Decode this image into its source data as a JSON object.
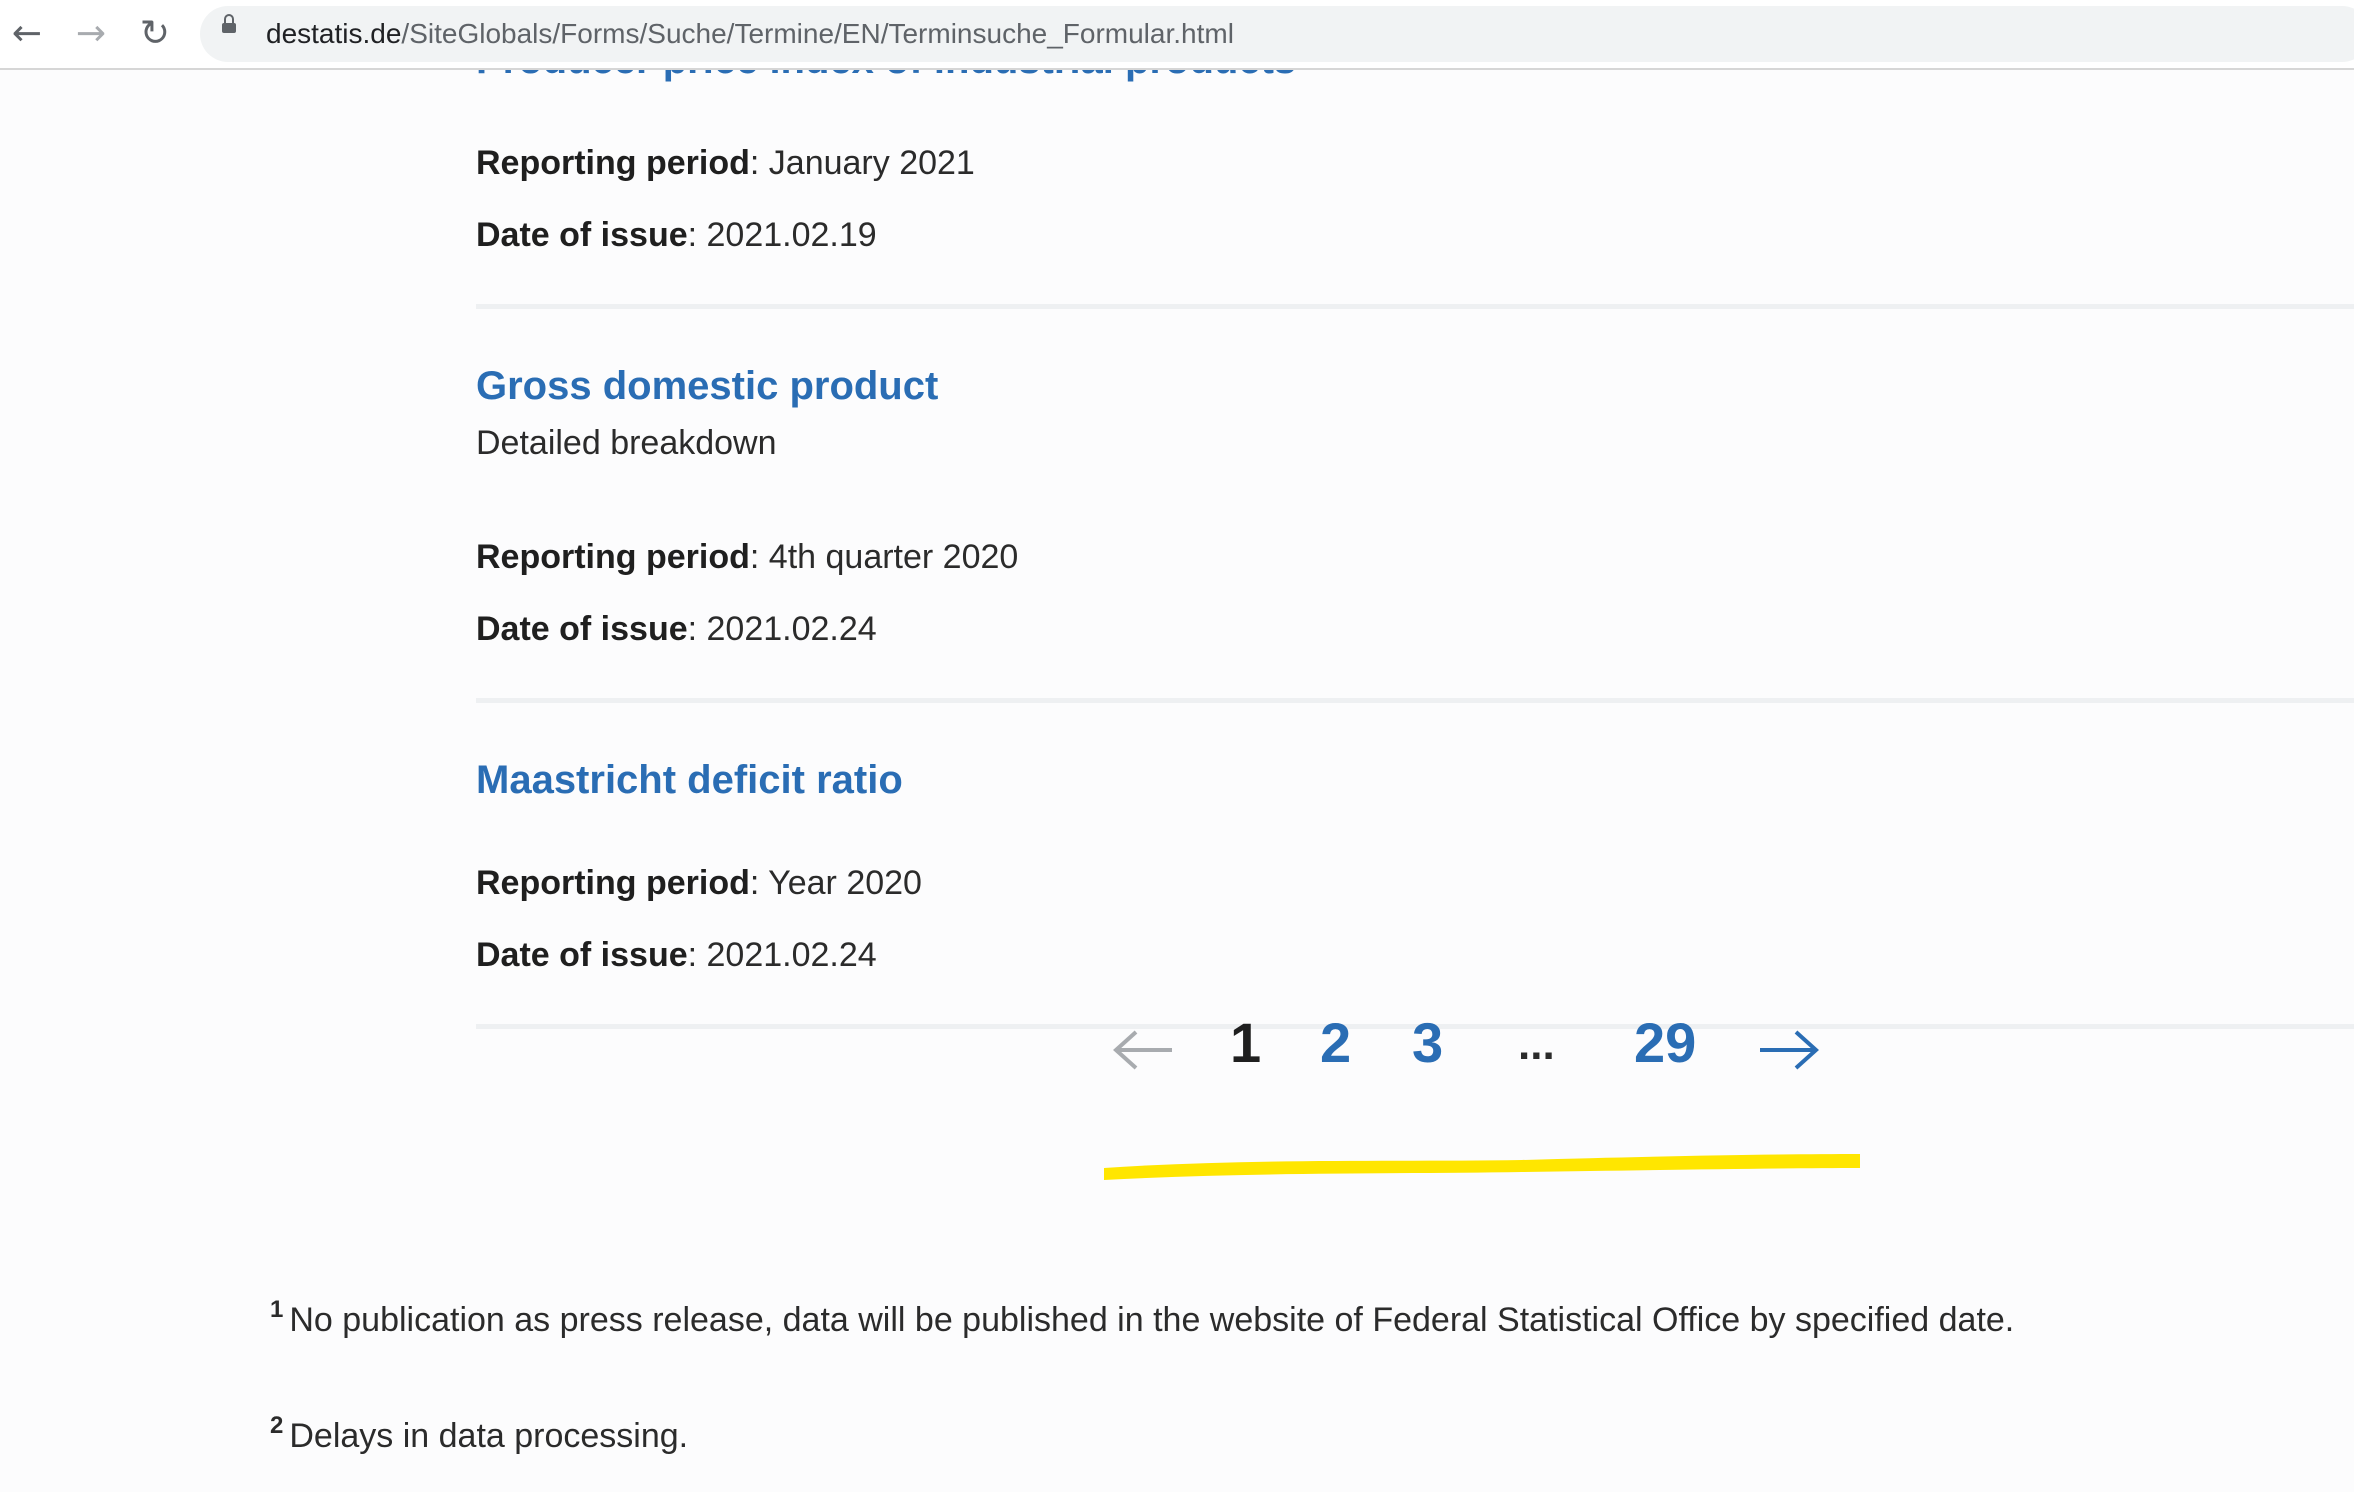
{
  "browser": {
    "url_host": "destatis.de",
    "url_path": "/SiteGlobals/Forms/Suche/Termine/EN/Terminsuche_Formular.html"
  },
  "entries": [
    {
      "title": "Producer price index of industrial products",
      "subtitle": "",
      "reporting_label": "Reporting period",
      "reporting_value": ": January 2021",
      "date_label": "Date of issue",
      "date_value": ": 2021.02.19"
    },
    {
      "title": "Gross domestic product",
      "subtitle": "Detailed breakdown",
      "reporting_label": "Reporting period",
      "reporting_value": ": 4th quarter 2020",
      "date_label": "Date of issue",
      "date_value": ": 2021.02.24"
    },
    {
      "title": "Maastricht deficit ratio",
      "subtitle": "",
      "reporting_label": "Reporting period",
      "reporting_value": ": Year 2020",
      "date_label": "Date of issue",
      "date_value": ": 2021.02.24"
    }
  ],
  "pagination": {
    "pages": [
      "1",
      "2",
      "3"
    ],
    "ellipsis": "...",
    "last": "29",
    "current": "1"
  },
  "footnotes": [
    {
      "marker": "1",
      "text": "No publication as press release, data will be published in the website of Federal Statistical Office by specified date."
    },
    {
      "marker": "2",
      "text": "Delays in data processing."
    }
  ],
  "colors": {
    "link": "#2a6db4",
    "highlight": "#ffe600"
  },
  "icons": {
    "back": "arrow-left-icon",
    "forward": "arrow-right-icon",
    "reload": "reload-icon",
    "lock": "lock-icon",
    "prev_page": "arrow-left-icon",
    "next_page": "arrow-right-icon"
  }
}
